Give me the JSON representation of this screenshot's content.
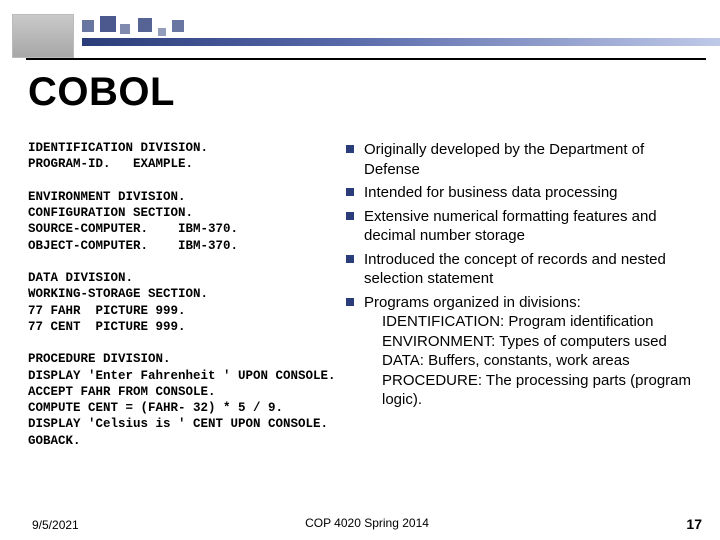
{
  "title": "COBOL",
  "code": "IDENTIFICATION DIVISION.\nPROGRAM-ID.   EXAMPLE.\n\nENVIRONMENT DIVISION.\nCONFIGURATION SECTION.\nSOURCE-COMPUTER.    IBM-370.\nOBJECT-COMPUTER.    IBM-370.\n\nDATA DIVISION.\nWORKING-STORAGE SECTION.\n77 FAHR  PICTURE 999.\n77 CENT  PICTURE 999.\n\nPROCEDURE DIVISION.\nDISPLAY 'Enter Fahrenheit ' UPON CONSOLE.\nACCEPT FAHR FROM CONSOLE.\nCOMPUTE CENT = (FAHR- 32) * 5 / 9.\nDISPLAY 'Celsius is ' CENT UPON CONSOLE.\nGOBACK.",
  "bullets": [
    {
      "text": "Originally developed by the Department of Defense"
    },
    {
      "text": "Intended for business data processing"
    },
    {
      "text": "Extensive numerical formatting features and decimal number storage"
    },
    {
      "text": "Introduced the concept of records and nested selection statement"
    },
    {
      "text": "Programs organized in divisions:",
      "subs": [
        "IDENTIFICATION: Program identification",
        "ENVIRONMENT: Types of computers used",
        "DATA: Buffers, constants, work areas",
        "PROCEDURE: The processing parts (program logic)."
      ]
    }
  ],
  "footer": {
    "date": "9/5/2021",
    "course": "COP 4020 Spring 2014",
    "page": "17"
  }
}
